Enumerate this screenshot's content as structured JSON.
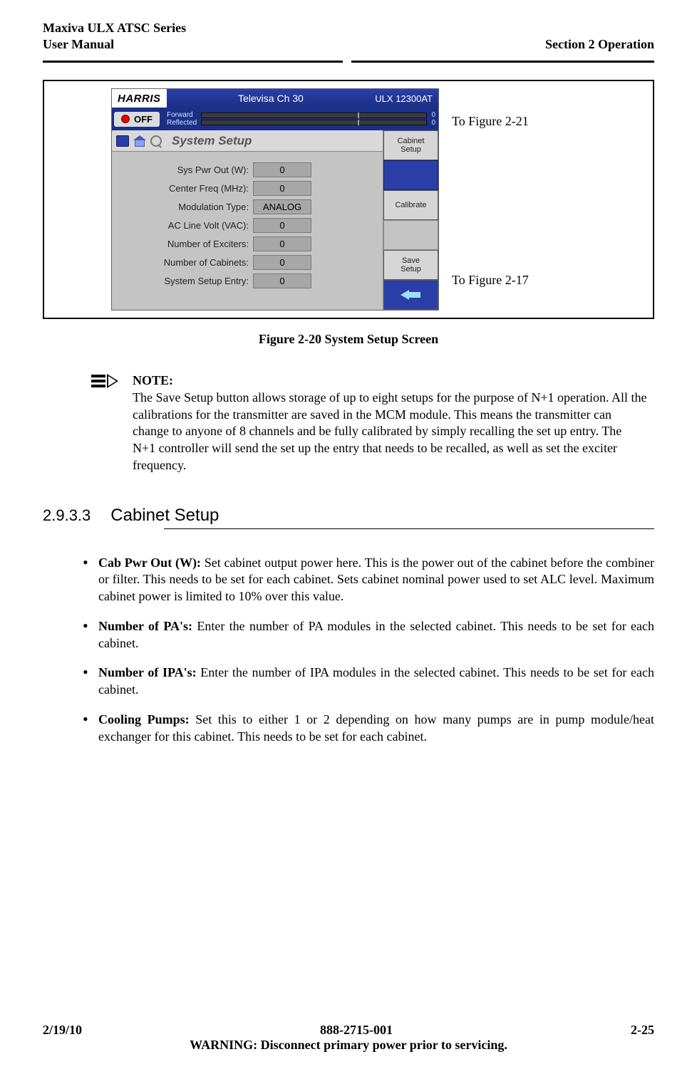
{
  "header": {
    "left_line1": "Maxiva ULX ATSC Series",
    "left_line2": "User Manual",
    "right": "Section 2 Operation"
  },
  "gui": {
    "logo": "HARRIS",
    "title": "Televisa Ch 30",
    "model": "ULX 12300AT",
    "off_label": "OFF",
    "forward_label": "Forward",
    "reflected_label": "Reflected",
    "forward_val": "0",
    "reflected_val": "0",
    "bc_title": "System Setup",
    "params": [
      {
        "label": "Sys Pwr Out (W):",
        "value": "0"
      },
      {
        "label": "Center Freq (MHz):",
        "value": "0"
      },
      {
        "label": "Modulation Type:",
        "value": "ANALOG"
      },
      {
        "label": "AC Line Volt (VAC):",
        "value": "0"
      },
      {
        "label": "Number of Exciters:",
        "value": "0"
      },
      {
        "label": "Number of Cabinets:",
        "value": "0"
      },
      {
        "label": "System Setup Entry:",
        "value": "0"
      }
    ],
    "side": {
      "cabinet_setup": "Cabinet\nSetup",
      "calibrate": "Calibrate",
      "save_setup": "Save\nSetup"
    }
  },
  "annotations": {
    "top": "To Figure 2-21",
    "bottom": "To Figure 2-17"
  },
  "figure_caption": "Figure 2-20  System Setup Screen",
  "note": {
    "head": "NOTE:",
    "body": "The Save Setup button allows storage of up to eight setups for the purpose of N+1 operation. All the calibrations for the transmitter are saved in the MCM module. This means the transmitter can change to anyone of 8 channels and be fully calibrated by simply recalling the set up entry. The N+1 controller will send the set up the entry that needs to be recalled, as well as set the exciter frequency."
  },
  "subsection": {
    "number": "2.9.3.3",
    "title": "Cabinet Setup"
  },
  "bullets": [
    {
      "bold": "Cab Pwr Out (W): ",
      "text": "Set cabinet output power here. This is the power out of the cabinet before the combiner or filter. This needs to be set for each cabinet. Sets cabinet nominal power used to set ALC level.  Maximum cabinet power is limited to 10% over this value."
    },
    {
      "bold": "Number of PA's: ",
      "text": "Enter the number of PA modules in the selected cabinet. This needs to be set for each cabinet."
    },
    {
      "bold": " Number of IPA's: ",
      "text": "Enter the number of IPA modules in the selected cabinet. This needs to be set for each cabinet."
    },
    {
      "bold": "Cooling Pumps: ",
      "text": "Set this to either 1 or 2 depending on how many pumps are in pump module/heat exchanger for this cabinet. This needs to be set for each cabinet."
    }
  ],
  "footer": {
    "date": "2/19/10",
    "docnum": "888-2715-001",
    "page": "2-25",
    "warning": "WARNING: Disconnect primary power prior to servicing."
  }
}
